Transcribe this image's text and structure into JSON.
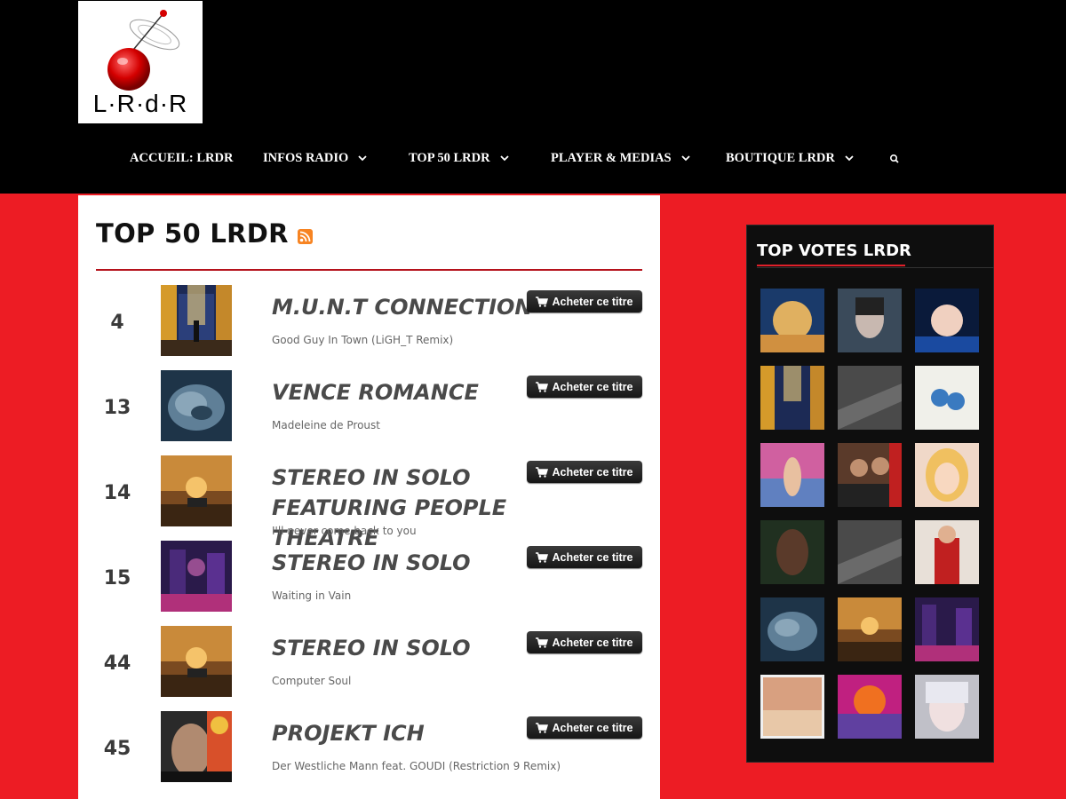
{
  "site": {
    "logo_text": "L·R·d·R"
  },
  "nav": {
    "items": [
      {
        "label": "ACCUEIL: LRDR"
      },
      {
        "label": "INFOS RADIO"
      },
      {
        "label": "TOP 50 LRDR"
      },
      {
        "label": "PLAYER & MEDIAS"
      },
      {
        "label": "BOUTIQUE LRDR"
      }
    ],
    "search_icon": "search-icon"
  },
  "main": {
    "title": "TOP 50 LRDR",
    "rss_icon": "rss-icon",
    "buy_label": "Acheter ce titre",
    "entries": [
      {
        "rank": "4",
        "artist": "M.U.N.T CONNECTION",
        "track": "Good Guy In Town (LiGH_T Remix)"
      },
      {
        "rank": "13",
        "artist": "VENCE ROMANCE",
        "track": "Madeleine de Proust"
      },
      {
        "rank": "14",
        "artist": "STEREO IN SOLO FEATURING PEOPLE THEATRE",
        "track": "I'll never come back to you"
      },
      {
        "rank": "15",
        "artist": "STEREO IN SOLO",
        "track": "Waiting in Vain"
      },
      {
        "rank": "44",
        "artist": "STEREO IN SOLO",
        "track": "Computer Soul"
      },
      {
        "rank": "45",
        "artist": "PROJEKT ICH",
        "track": "Der Westliche Mann feat. GOUDI (Restriction 9 Remix)"
      }
    ]
  },
  "sidebar": {
    "title": "TOP VOTES LRDR"
  },
  "colors": {
    "background_red": "#ed1c24",
    "header_black": "#000000",
    "accent_red": "#b5121b"
  }
}
